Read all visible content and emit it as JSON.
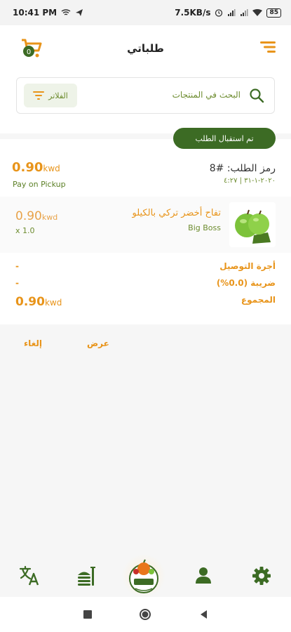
{
  "status_bar": {
    "time": "10:41 PM",
    "network_speed": "7.5KB/s",
    "battery": "85"
  },
  "header": {
    "title": "طلباتي",
    "cart_icon": "cart-icon",
    "menu_icon": "menu-icon"
  },
  "search": {
    "placeholder": "البحث في المنتجات",
    "filter_label": "الفلاتر"
  },
  "order": {
    "status": "تم استقبال الطلب",
    "code": "رمز الطلب: #8",
    "date": "٢٠٢٠-١-٣١ | ٤:٢٧",
    "total_value": "0.90",
    "currency": "kwd",
    "payment_method": "Pay on Pickup",
    "item": {
      "name": "تفاح أخضر تركي بالكيلو",
      "brand": "Big Boss",
      "price": "0.90",
      "currency": "kwd",
      "quantity": "x 1.0"
    },
    "summary": {
      "delivery_label": "أجرة التوصيل",
      "delivery_value": "-",
      "tax_label": "ضريبة (0.0%)",
      "tax_value": "-",
      "total_label": "المجموع",
      "total_value": "0.90",
      "currency": "kwd"
    },
    "actions": {
      "view_label": "عرض",
      "cancel_label": "إلغاء"
    }
  },
  "colors": {
    "primary_green": "#3c6b24",
    "accent_orange": "#e8941a",
    "label_green": "#6d8c2f"
  }
}
